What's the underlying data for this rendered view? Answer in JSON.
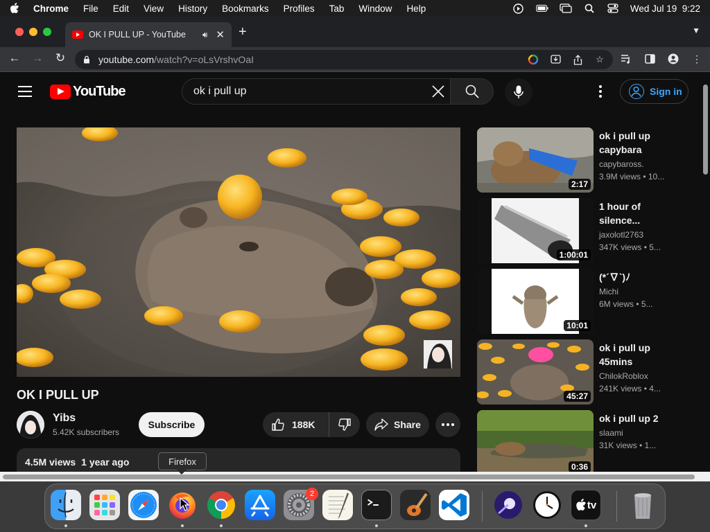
{
  "menubar": {
    "items": [
      "Chrome",
      "File",
      "Edit",
      "View",
      "History",
      "Bookmarks",
      "Profiles",
      "Tab",
      "Window",
      "Help"
    ],
    "clock": "Wed Jul 19  9:22"
  },
  "browser": {
    "tab_title": "OK I PULL UP - YouTube",
    "url_host": "youtube.com",
    "url_path": "/watch?v=oLsVrshvOaI"
  },
  "youtube": {
    "logo_text": "YouTube",
    "search_value": "ok i pull up",
    "signin_label": "Sign in",
    "video": {
      "title": "OK I PULL UP",
      "channel": "Yibs",
      "subscribers": "5.42K subscribers",
      "subscribe_label": "Subscribe",
      "likes": "188K",
      "share_label": "Share",
      "views": "4.5M views",
      "age": "1 year ago"
    },
    "recommendations": [
      {
        "title": "ok i pull up capybara",
        "channel": "capybaross.",
        "meta": "3.9M views  •  10...",
        "duration": "2:17"
      },
      {
        "title": "1 hour of silence...",
        "channel": "jaxolotl2763",
        "meta": "347K views  •  5...",
        "duration": "1:00:01"
      },
      {
        "title": "(*´∇`)ﾉ",
        "channel": "Michi",
        "meta": "6M views  •  5...",
        "duration": "10:01"
      },
      {
        "title": "ok i pull up 45mins",
        "channel": "ChilokRoblox",
        "meta": "241K views  •  4...",
        "duration": "45:27"
      },
      {
        "title": "ok i pull up 2",
        "channel": "slaami",
        "meta": "31K views  •  1...",
        "duration": "0:36"
      }
    ]
  },
  "dock": {
    "tooltip": "Firefox",
    "settings_badge": "2",
    "tv_label": "tv"
  },
  "colors": {
    "youtube_red": "#ff0000",
    "link_blue": "#3ea6ff",
    "page_bg": "#0f0f0f"
  }
}
